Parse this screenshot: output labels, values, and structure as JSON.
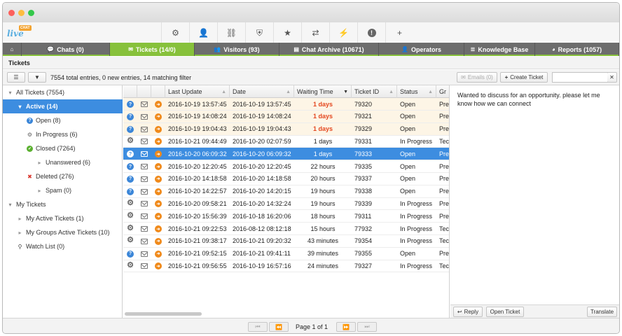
{
  "app": {
    "logo_badge": "CHAT",
    "logo_word": "live"
  },
  "colors": {
    "accent": "#87c13b",
    "selection": "#3d8de0",
    "urgent": "#e4471f",
    "tabbar": "#6d6d6d"
  },
  "toolbar_icons": [
    "settings-icon",
    "user-icon",
    "link-icon",
    "shield-icon",
    "star-icon",
    "translate-icon",
    "bolt-icon",
    "alert-icon",
    "plus-icon"
  ],
  "tabs": [
    {
      "label": "",
      "icon": "home-icon"
    },
    {
      "label": "Chats (0)",
      "icon": "chat-icon"
    },
    {
      "label": "Tickets (14/0)",
      "icon": "envelope-icon",
      "active": true
    },
    {
      "label": "Visitors (93)",
      "icon": "visitors-icon"
    },
    {
      "label": "Chat Archive (10671)",
      "icon": "archive-icon"
    },
    {
      "label": "Operators",
      "icon": "operator-icon"
    },
    {
      "label": "Knowledge Base",
      "icon": "database-icon"
    },
    {
      "label": "Reports (1057)",
      "icon": "pie-icon"
    }
  ],
  "breadcrumb": "Tickets",
  "actions": {
    "summary": "7554 total entries, 0 new entries, 14 matching filter",
    "emails": "Emails (0)",
    "create_ticket": "Create Ticket",
    "search_value": ""
  },
  "tree": [
    {
      "label": "All Tickets (7554)",
      "indent": 0,
      "icon": "caret-down"
    },
    {
      "label": "Active (14)",
      "indent": 1,
      "icon": "caret-down",
      "selected": true
    },
    {
      "label": "Open (8)",
      "indent": 2,
      "icon": "question"
    },
    {
      "label": "In Progress (6)",
      "indent": 2,
      "icon": "gear"
    },
    {
      "label": "Closed (7264)",
      "indent": 2,
      "icon": "check"
    },
    {
      "label": "Unanswered (6)",
      "indent": 3,
      "icon": "caret-right"
    },
    {
      "label": "Deleted (276)",
      "indent": 2,
      "icon": "cross"
    },
    {
      "label": "Spam (0)",
      "indent": 3,
      "icon": "caret-right"
    },
    {
      "label": "My Tickets",
      "indent": 0,
      "icon": "caret-down"
    },
    {
      "label": "My Active Tickets (1)",
      "indent": 1,
      "icon": "caret-right"
    },
    {
      "label": "My Groups Active Tickets (10)",
      "indent": 1,
      "icon": "caret-right"
    },
    {
      "label": "Watch List (0)",
      "indent": 1,
      "icon": "binoculars"
    }
  ],
  "columns": [
    "Last Update",
    "Date",
    "Waiting Time",
    "Ticket ID",
    "Status",
    "Gr"
  ],
  "rows": [
    {
      "type": "q",
      "last": "2016-10-19 13:57:45",
      "date": "2016-10-19 13:57:45",
      "wait": "1 days",
      "id": "79320",
      "status": "Open",
      "group": "Pre",
      "urgent": true
    },
    {
      "type": "q",
      "last": "2016-10-19 14:08:24",
      "date": "2016-10-19 14:08:24",
      "wait": "1 days",
      "id": "79321",
      "status": "Open",
      "group": "Pre",
      "urgent": true
    },
    {
      "type": "q",
      "last": "2016-10-19 19:04:43",
      "date": "2016-10-19 19:04:43",
      "wait": "1 days",
      "id": "79329",
      "status": "Open",
      "group": "Pre",
      "urgent": true
    },
    {
      "type": "g",
      "last": "2016-10-21 09:44:49",
      "date": "2016-10-20 02:07:59",
      "wait": "1 days",
      "id": "79331",
      "status": "In Progress",
      "group": "Tec",
      "urgent": false
    },
    {
      "type": "q",
      "last": "2016-10-20 06:09:32",
      "date": "2016-10-20 06:09:32",
      "wait": "1 days",
      "id": "79333",
      "status": "Open",
      "group": "Pre",
      "urgent": false,
      "selected": true
    },
    {
      "type": "q",
      "last": "2016-10-20 12:20:45",
      "date": "2016-10-20 12:20:45",
      "wait": "22 hours",
      "id": "79335",
      "status": "Open",
      "group": "Pre",
      "urgent": false
    },
    {
      "type": "q",
      "last": "2016-10-20 14:18:58",
      "date": "2016-10-20 14:18:58",
      "wait": "20 hours",
      "id": "79337",
      "status": "Open",
      "group": "Pre",
      "urgent": false
    },
    {
      "type": "q",
      "last": "2016-10-20 14:22:57",
      "date": "2016-10-20 14:20:15",
      "wait": "19 hours",
      "id": "79338",
      "status": "Open",
      "group": "Pre",
      "urgent": false
    },
    {
      "type": "g",
      "last": "2016-10-20 09:58:21",
      "date": "2016-10-20 14:32:24",
      "wait": "19 hours",
      "id": "79339",
      "status": "In Progress",
      "group": "Pre",
      "urgent": false
    },
    {
      "type": "g",
      "last": "2016-10-20 15:56:39",
      "date": "2016-10-18 16:20:06",
      "wait": "18 hours",
      "id": "79311",
      "status": "In Progress",
      "group": "Pre",
      "urgent": false
    },
    {
      "type": "g",
      "last": "2016-10-21 09:22:53",
      "date": "2016-08-12 08:12:18",
      "wait": "15 hours",
      "id": "77932",
      "status": "In Progress",
      "group": "Tec",
      "urgent": false
    },
    {
      "type": "g",
      "last": "2016-10-21 09:38:17",
      "date": "2016-10-21 09:20:32",
      "wait": "43 minutes",
      "id": "79354",
      "status": "In Progress",
      "group": "Tec",
      "urgent": false
    },
    {
      "type": "q",
      "last": "2016-10-21 09:52:15",
      "date": "2016-10-21 09:41:11",
      "wait": "39 minutes",
      "id": "79355",
      "status": "Open",
      "group": "Pre",
      "urgent": false
    },
    {
      "type": "g",
      "last": "2016-10-21 09:56:55",
      "date": "2016-10-19 16:57:16",
      "wait": "24 minutes",
      "id": "79327",
      "status": "In Progress",
      "group": "Tec",
      "urgent": false
    }
  ],
  "preview": {
    "message": "Wanted to discuss for an opportunity. please let me know how we can connect",
    "reply": "Reply",
    "open_ticket": "Open Ticket",
    "translate": "Translate"
  },
  "pager": {
    "label": "Page 1 of 1"
  }
}
